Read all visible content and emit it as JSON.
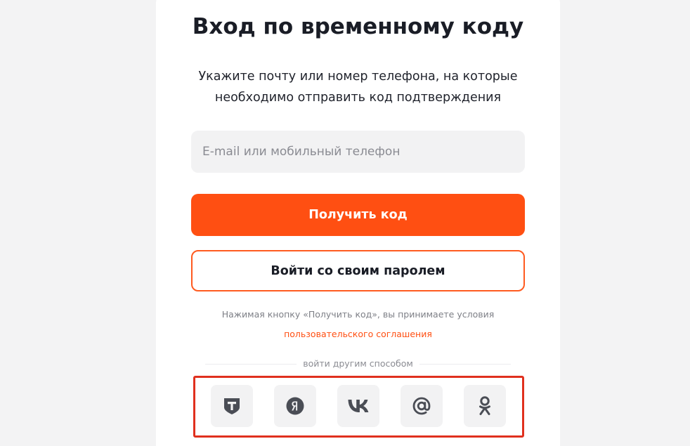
{
  "login": {
    "title": "Вход по временному коду",
    "subtitle": "Укажите почту или номер телефона, на которые необходимо отправить код подтверждения",
    "input_placeholder": "E-mail или мобильный телефон",
    "input_value": "",
    "get_code_label": "Получить код",
    "password_login_label": "Войти со своим паролем",
    "terms_text": "Нажимая кнопку «Получить код», вы принимаете условия",
    "terms_link": "пользовательского соглашения",
    "alt_login_label": "войти другим способом"
  },
  "social": [
    {
      "icon": "tbank-icon"
    },
    {
      "icon": "yandex-icon"
    },
    {
      "icon": "vk-icon"
    },
    {
      "icon": "mail-ru-icon"
    },
    {
      "icon": "odnoklassniki-icon"
    }
  ],
  "colors": {
    "accent": "#ff4f12",
    "highlight_border": "#e0301e",
    "icon": "#4a4d55",
    "text": "#1a1d26"
  }
}
